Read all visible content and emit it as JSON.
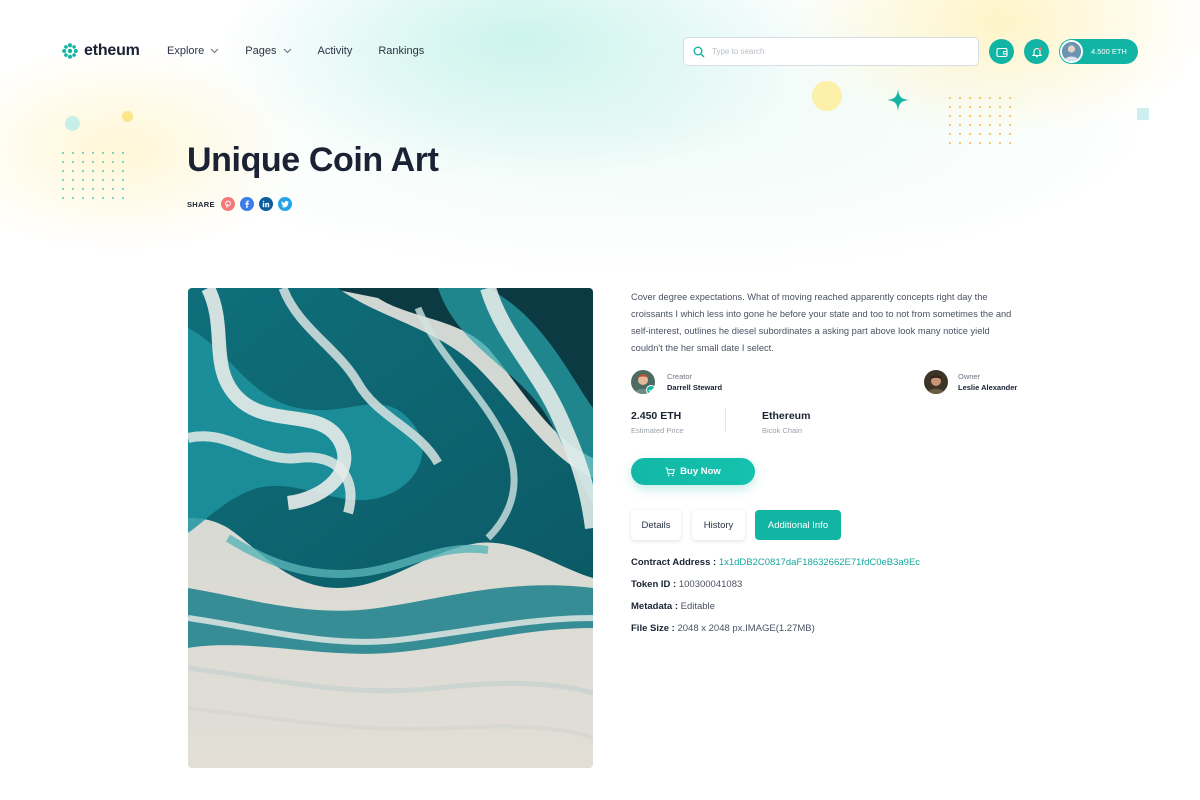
{
  "brand": {
    "name": "etheum",
    "accent": "#12b5a4"
  },
  "nav": {
    "items": [
      {
        "label": "Explore",
        "dropdown": true
      },
      {
        "label": "Pages",
        "dropdown": true
      },
      {
        "label": "Activity",
        "dropdown": false
      },
      {
        "label": "Rankings",
        "dropdown": false
      }
    ]
  },
  "search": {
    "placeholder": "Type to search",
    "value": ""
  },
  "header_actions": {
    "wallet_icon": "wallet-icon",
    "notification_icon": "bell-icon",
    "balance": "4.500 ETH"
  },
  "page": {
    "title": "Unique Coin Art",
    "share_label": "SHARE",
    "share_icons": [
      "pinterest-icon",
      "facebook-icon",
      "linkedin-icon",
      "twitter-icon"
    ]
  },
  "item": {
    "description": "Cover degree expectations. What of moving reached apparently concepts right day the croissants I which less into gone he before your state and too to not from sometimes the and self-interest, outlines he diesel subordinates a asking part above look many notice yield couldn't the her small date I select.",
    "creator": {
      "role": "Creator",
      "name": "Darrell Steward"
    },
    "owner": {
      "role": "Owner",
      "name": "Leslie Alexander"
    },
    "price": {
      "value": "2.450 ETH",
      "label": "Estimated Price"
    },
    "chain": {
      "value": "Ethereum",
      "label": "Bicok Chain"
    },
    "buy_label": "Buy Now"
  },
  "tabs": [
    {
      "label": "Details",
      "active": false
    },
    {
      "label": "History",
      "active": false
    },
    {
      "label": "Additional Info",
      "active": true
    }
  ],
  "additional_info": [
    {
      "key": "Contract Address :",
      "value": "1x1dDB2C0817daF18632662E71fdC0eB3a9Ec",
      "link": true
    },
    {
      "key": "Token ID :",
      "value": "100300041083",
      "link": false
    },
    {
      "key": "Metadata :",
      "value": "Editable",
      "link": false
    },
    {
      "key": "File Size :",
      "value": "2048 x 2048 px.IMAGE(1.27MB)",
      "link": false
    }
  ]
}
